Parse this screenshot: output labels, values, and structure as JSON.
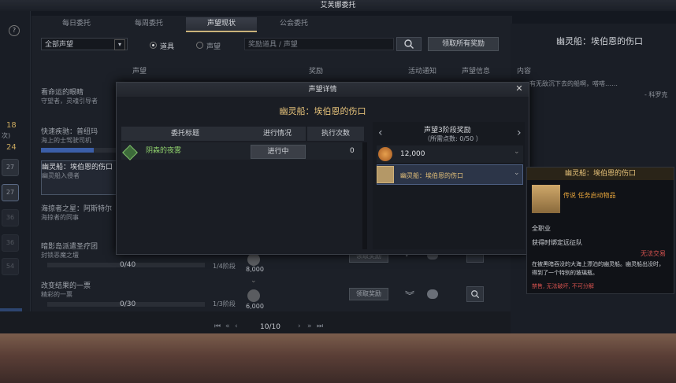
{
  "window": {
    "title": "艾芙娜委托"
  },
  "tabs": [
    {
      "label": "每日委托"
    },
    {
      "label": "每周委托"
    },
    {
      "label": "声望现状"
    },
    {
      "label": "公会委托"
    }
  ],
  "left_strip": {
    "help_icon": "?",
    "num1": "18",
    "sub1": "次)",
    "num2": "24"
  },
  "filters": {
    "dropdown_value": "全部声望",
    "radio1": "道具",
    "radio2": "声望",
    "search_placeholder": "奖励道具 / 声望",
    "claim_all": "领取所有奖励"
  },
  "columns": {
    "rep": "声望",
    "reward": "奖励",
    "notify": "活动通知",
    "info": "声望信息"
  },
  "list": [
    {
      "title": "看命运的眼睛",
      "sub": "守望者，灵魂引导者"
    },
    {
      "title": "快速疾驰：普纽玛",
      "sub": "海上的士驾驶司机"
    },
    {
      "title": "幽灵船：埃伯恩的伤口",
      "sub": "幽灵船入侵者"
    },
    {
      "title": "海掠者之星：阿斯特尔",
      "sub": "海掠者的同事"
    },
    {
      "title": "暗影岛派遣圣疗团",
      "sub": "封锁恶魔之壇",
      "progress": "0/40",
      "tier": "1/4阶段",
      "reward": "8,000",
      "claim": "领取奖励"
    },
    {
      "title": "改变结果的一票",
      "sub": "精彩的一票",
      "progress": "0/30",
      "tier": "1/3阶段",
      "reward": "6,000",
      "claim": "领取奖励"
    }
  ],
  "side_icons": [
    "27",
    "27",
    "36",
    "36",
    "54"
  ],
  "pagination": {
    "page": "10/10"
  },
  "right_panel": {
    "title": "幽灵船：埃伯恩的伤口",
    "content_label": "内容",
    "quote": "有无敌沉下去的船啊，嗒嗒……",
    "quote_author": "- 科罗克"
  },
  "modal": {
    "header": "声望详情",
    "title": "幽灵船：埃伯恩的伤口",
    "columns": {
      "task": "委托标题",
      "status": "进行情况",
      "count": "执行次数"
    },
    "tasks": [
      {
        "title": "阴森的夜雾",
        "status": "进行中",
        "count": "0"
      }
    ],
    "reward_header": "声望3阶段奖励",
    "reward_sub": "（所需点数: 0/50 ）",
    "rewards": [
      {
        "label": "12,000"
      },
      {
        "label": "幽灵船：埃伯恩的伤口"
      }
    ]
  },
  "tooltip": {
    "title": "幽灵船：埃伯恩的伤口",
    "item_type": "传说 任务启动物品",
    "class": "全职业",
    "bind": "获得时绑定远征队",
    "trade": "无法交易",
    "desc": "在被黑暗吞没的大海上漂泊的幽灵船。幽灵船出没时，得到了一个特别的玻璃瓶。",
    "flags": "禁售, 无法破坏, 不可分解"
  },
  "colors": {
    "accent": "#e6c27a",
    "progress": "#3b5ea8",
    "warn": "#d9534f"
  }
}
